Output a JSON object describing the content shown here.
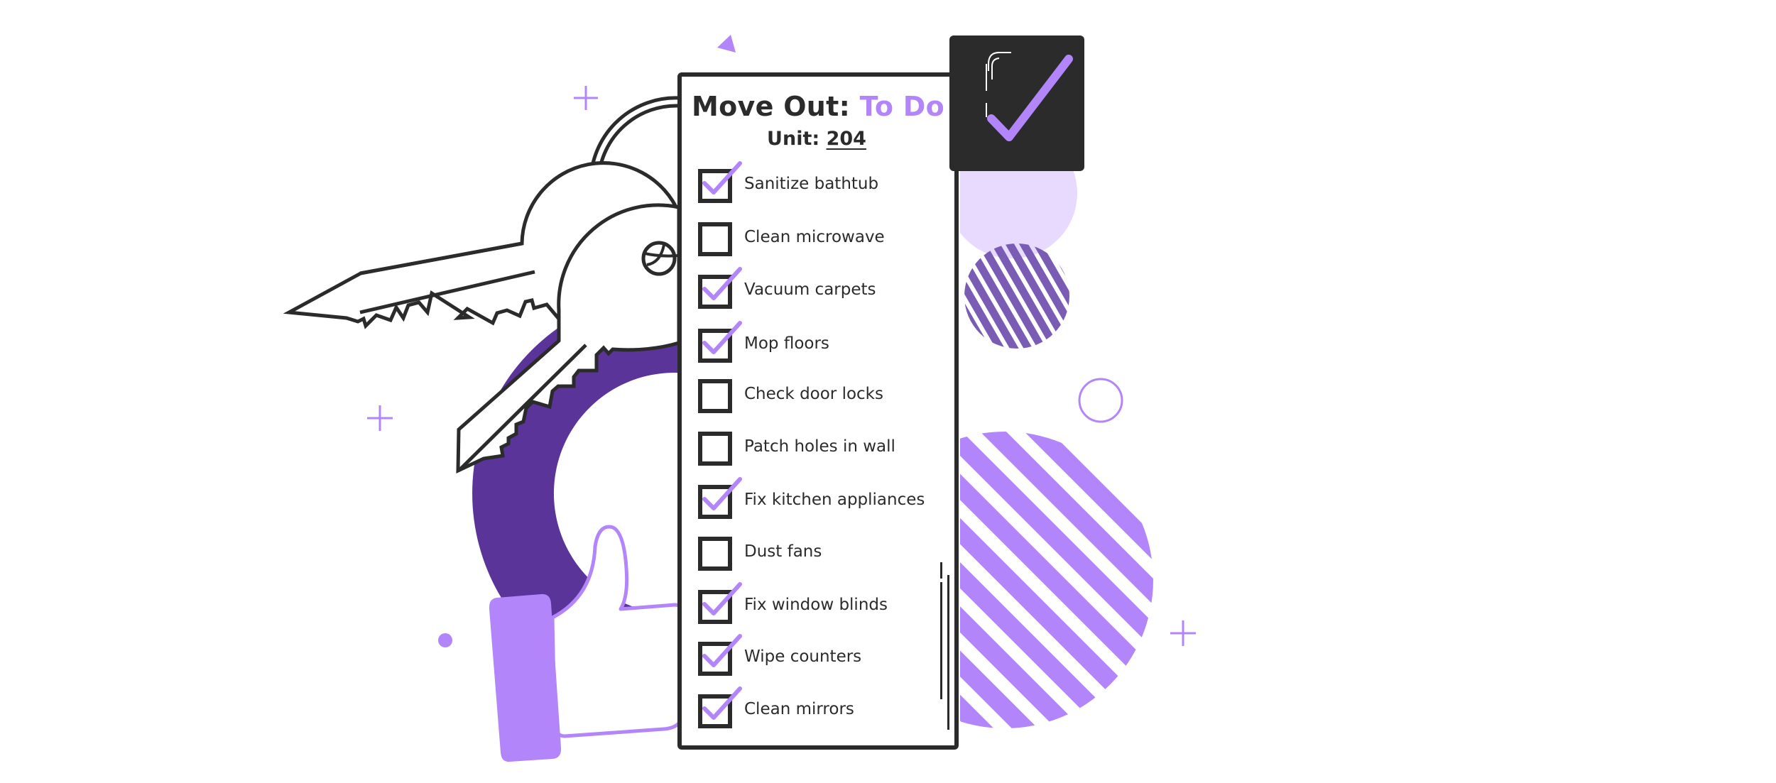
{
  "checklist": {
    "title_main": "Move Out: ",
    "title_accent": "To Do",
    "unit_label": "Unit: ",
    "unit_value": "204",
    "items": [
      {
        "label": "Sanitize bathtub",
        "checked": true
      },
      {
        "label": "Clean microwave",
        "checked": false
      },
      {
        "label": "Vacuum carpets",
        "checked": true
      },
      {
        "label": "Mop floors",
        "checked": true
      },
      {
        "label": "Check door locks",
        "checked": false
      },
      {
        "label": "Patch holes in wall",
        "checked": false
      },
      {
        "label": "Fix kitchen appliances",
        "checked": true
      },
      {
        "label": "Dust fans",
        "checked": false
      },
      {
        "label": "Fix window blinds",
        "checked": true
      },
      {
        "label": "Wipe counters",
        "checked": true
      },
      {
        "label": "Clean mirrors",
        "checked": true
      }
    ]
  },
  "badge": {
    "icon": "checkmark-icon"
  },
  "colors": {
    "ink": "#2b2b2b",
    "accent": "#b385fb",
    "deep_purple": "#5b3499",
    "light_purple": "#e8d9ff",
    "stripe_purple": "#7b5cb5"
  }
}
